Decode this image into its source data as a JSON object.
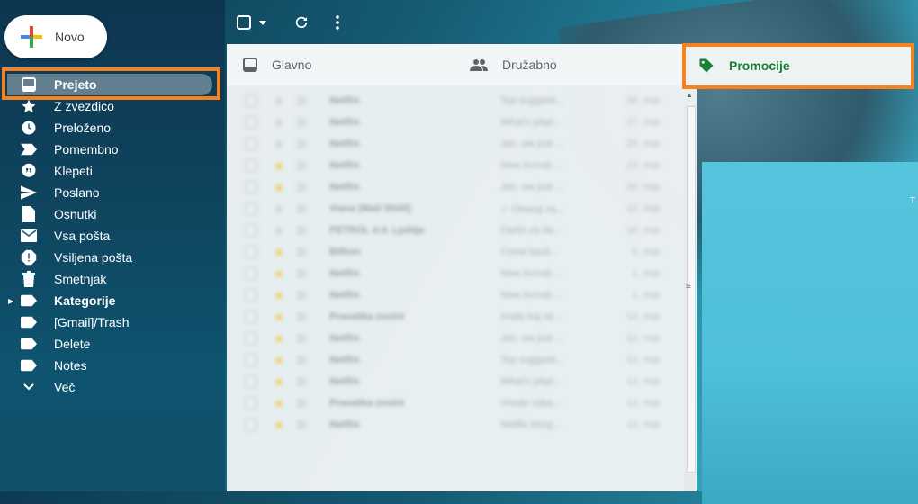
{
  "compose": {
    "label": "Novo"
  },
  "sidebar": {
    "items": [
      {
        "label": "Prejeto",
        "icon": "inbox-icon",
        "active": true
      },
      {
        "label": "Z zvezdico",
        "icon": "star-icon"
      },
      {
        "label": "Preloženo",
        "icon": "clock-icon"
      },
      {
        "label": "Pomembno",
        "icon": "important-icon"
      },
      {
        "label": "Klepeti",
        "icon": "chat-icon"
      },
      {
        "label": "Poslano",
        "icon": "send-icon"
      },
      {
        "label": "Osnutki",
        "icon": "draft-icon"
      },
      {
        "label": "Vsa pošta",
        "icon": "mail-icon"
      },
      {
        "label": "Vsiljena pošta",
        "icon": "spam-icon"
      },
      {
        "label": "Smetnjak",
        "icon": "trash-icon"
      },
      {
        "label": "Kategorije",
        "icon": "label-icon",
        "bold": true
      },
      {
        "label": "[Gmail]/Trash",
        "icon": "label-icon"
      },
      {
        "label": "Delete",
        "icon": "label-icon"
      },
      {
        "label": "Notes",
        "icon": "label-icon"
      },
      {
        "label": "Več",
        "icon": "chevron-down-icon"
      }
    ]
  },
  "tabs": [
    {
      "label": "Glavno",
      "icon": "inbox-icon"
    },
    {
      "label": "Družabno",
      "icon": "people-icon"
    },
    {
      "label": "Promocije",
      "icon": "tag-icon"
    }
  ],
  "right_letter": "T",
  "colors": {
    "highlight": "#f58220",
    "promo": "#188038"
  },
  "messages": [
    {
      "from": "Netflix",
      "subject": "Top suggesti...",
      "date": "28. mar.",
      "starred": false
    },
    {
      "from": "Netflix",
      "subject": "What's playi...",
      "date": "27. mar.",
      "starred": false
    },
    {
      "from": "Netflix",
      "subject": "Jan, we just ...",
      "date": "25. mar.",
      "starred": false
    },
    {
      "from": "Netflix",
      "subject": "New Arrival:...",
      "date": "23. mar.",
      "starred": true
    },
    {
      "from": "Netflix",
      "subject": "Jan, we just ...",
      "date": "26. mar.",
      "starred": true
    },
    {
      "from": "Viana (Mail Shtili)",
      "subject": "✓ Obseqi za...",
      "date": "12. mar.",
      "starred": false
    },
    {
      "from": "PETROL d.d. Ljublja",
      "subject": "Darilo za da...",
      "date": "16. mar.",
      "starred": false
    },
    {
      "from": "Bithon",
      "subject": "Come back...",
      "date": "6. mar.",
      "starred": true
    },
    {
      "from": "Netflix",
      "subject": "New Arrival:...",
      "date": "1. mar.",
      "starred": true
    },
    {
      "from": "Netflix",
      "subject": "New Arrival:...",
      "date": "1. mar.",
      "starred": true
    },
    {
      "from": "Pravaška zvoint",
      "subject": "Imate kaj ve...",
      "date": "14. mar.",
      "starred": true
    },
    {
      "from": "Netflix",
      "subject": "Jan, we just ...",
      "date": "12. mar.",
      "starred": true
    },
    {
      "from": "Netflix",
      "subject": "Top suggesti...",
      "date": "12. mar.",
      "starred": true
    },
    {
      "from": "Netflix",
      "subject": "What's playi...",
      "date": "12. mar.",
      "starred": true
    },
    {
      "from": "Pravaška zvoint",
      "subject": "Vreabi vaba...",
      "date": "12. mar.",
      "starred": true
    },
    {
      "from": "Netflix",
      "subject": "Netflix bring...",
      "date": "12. mar.",
      "starred": true
    }
  ]
}
